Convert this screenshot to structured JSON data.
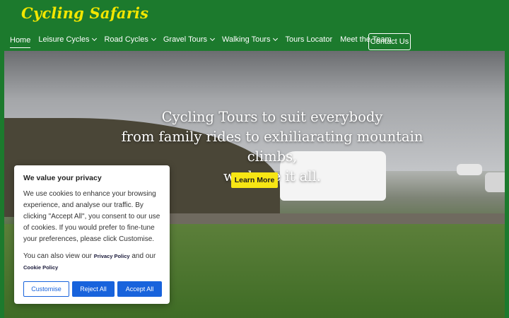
{
  "header": {
    "logo": "Cycling Safaris",
    "nav": [
      {
        "label": "Home",
        "active": true,
        "dropdown": false
      },
      {
        "label": "Leisure Cycles",
        "dropdown": true
      },
      {
        "label": "Road Cycles",
        "dropdown": true
      },
      {
        "label": "Gravel Tours",
        "dropdown": true
      },
      {
        "label": "Walking Tours",
        "dropdown": true
      },
      {
        "label": "Tours Locator",
        "dropdown": false
      },
      {
        "label": "Meet the Team",
        "dropdown": false
      }
    ],
    "contact_label": "Contact Us"
  },
  "hero": {
    "line1": "Cycling Tours to suit everybody",
    "line2": "from family rides to exhiliarating mountain climbs,",
    "line3": "we have it all.",
    "cta_label": "Learn More"
  },
  "cookie": {
    "title": "We value your privacy",
    "body": "We use cookies to enhance your browsing experience, and analyse our traffic. By clicking \"Accept All\", you consent to our use of cookies.  If you would prefer to  fine-tune your preferences, please click Customise.",
    "policy_prefix": "You can also view our",
    "privacy_link": "Privacy Policy",
    "policy_and": "and our",
    "cookie_link": "Cookie Policy",
    "customise_label": "Customise",
    "reject_label": "Reject All",
    "accept_label": "Accept All"
  },
  "colors": {
    "header_bg": "#1c7a2d",
    "logo": "#f2e600",
    "cta_bg": "#f7e614",
    "cookie_btn": "#1863dc"
  }
}
